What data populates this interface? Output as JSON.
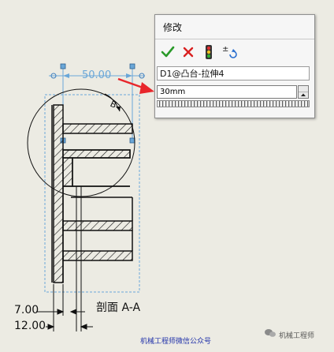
{
  "dialog": {
    "title": "修改",
    "dimension_name": "D1@凸台-拉伸4",
    "value": "30mm",
    "toolbar": {
      "ok_icon": "checkmark-icon",
      "cancel_icon": "x-icon",
      "rebuild_icon": "traffic-light-icon",
      "regenerate_icon": "plus-minus-regenerate-icon"
    }
  },
  "drawing": {
    "dimension_value": "50.00",
    "dim_7": "7.00",
    "dim_12": "12.00",
    "section_label": "剖面 A-A",
    "detail_letter": "B"
  },
  "footer": {
    "note": "机械工程师微信公众号",
    "watermark": "机械工程师"
  },
  "colors": {
    "background": "#ecebe3",
    "dimension_blue": "#6aa7d8",
    "arrow_red": "#e8262b",
    "ok_green": "#2a9a2a",
    "cancel_red": "#d92020"
  }
}
